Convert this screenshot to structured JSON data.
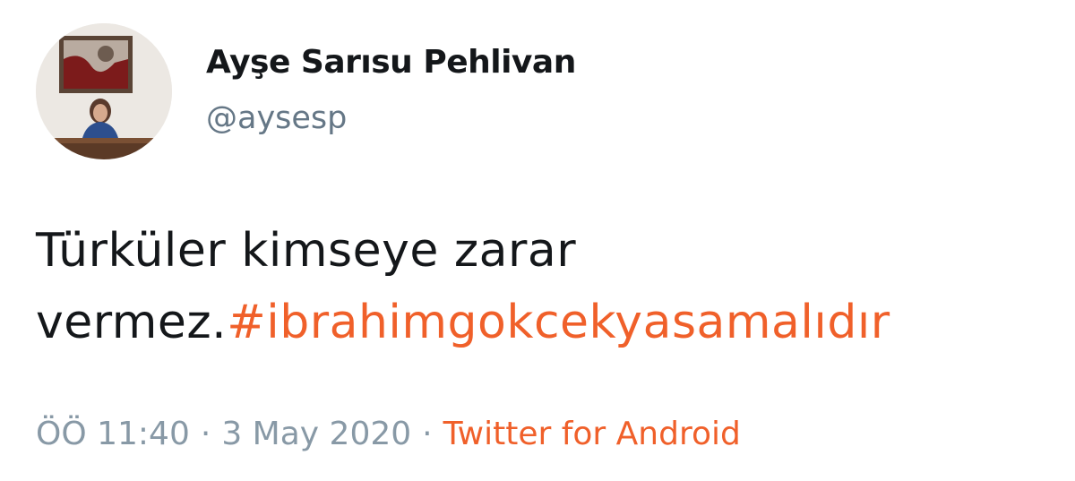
{
  "author": {
    "name": "Ayşe Sarısu Pehlivan",
    "handle": "@aysesp"
  },
  "tweet": {
    "text_line1": "Türküler kimseye zarar",
    "text_line2_prefix": "vermez.",
    "hashtag": "#ibrahimgokcekyasamalıdır"
  },
  "meta": {
    "time": "ÖÖ 11:40",
    "separator": "·",
    "date": "3 May 2020",
    "source": "Twitter for Android"
  },
  "colors": {
    "link": "#f0602a",
    "text": "#14171a",
    "secondary": "#657786"
  }
}
